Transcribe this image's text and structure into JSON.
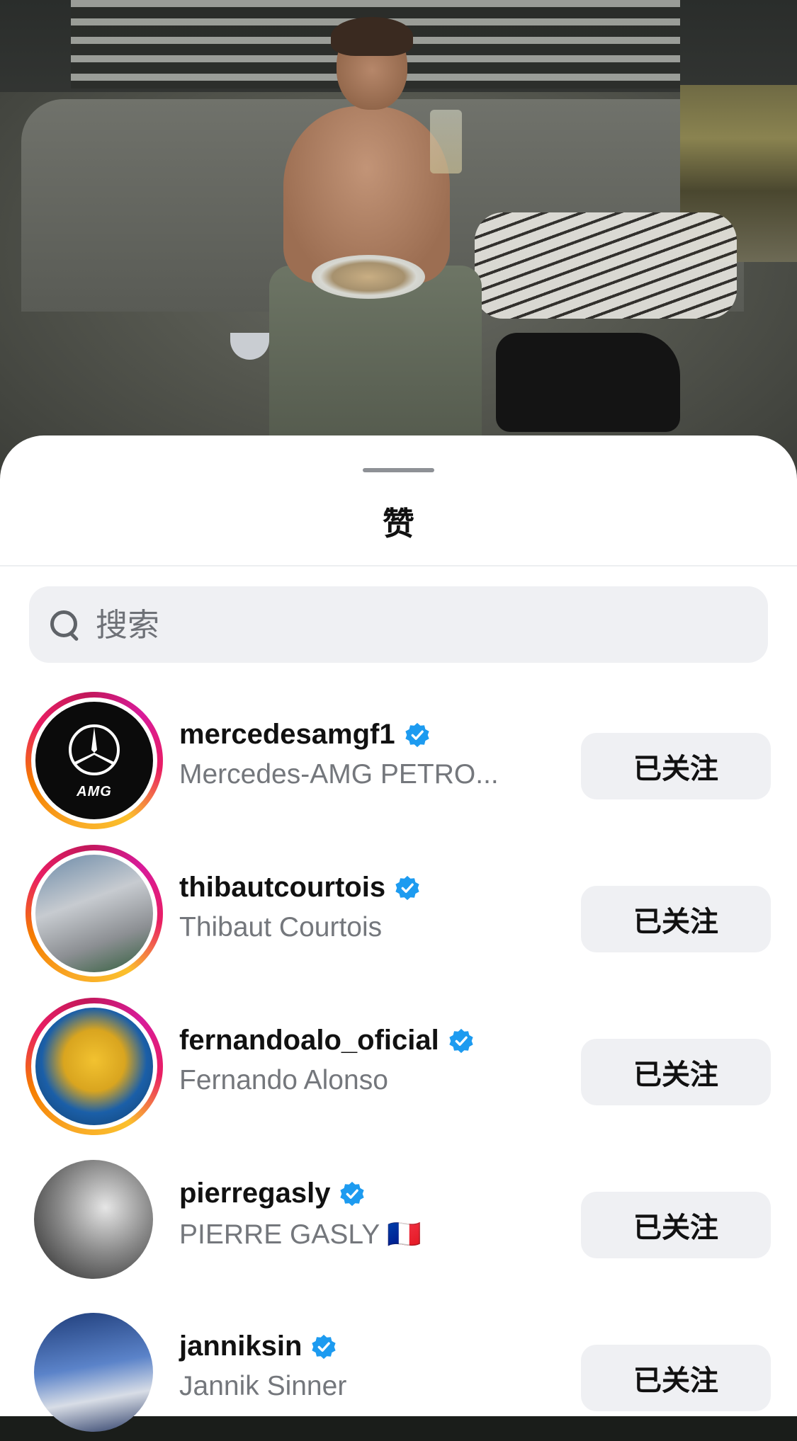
{
  "sheet": {
    "title": "赞"
  },
  "search": {
    "placeholder": "搜索"
  },
  "likers": [
    {
      "username": "mercedesamgf1",
      "full_name": "Mercedes-AMG PETRO...",
      "verified": true,
      "story_ring": true,
      "button": "已关注",
      "avatar_text": "AMG"
    },
    {
      "username": "thibautcourtois",
      "full_name": "Thibaut Courtois",
      "verified": true,
      "story_ring": true,
      "button": "已关注"
    },
    {
      "username": "fernandoalo_oficial",
      "full_name": "Fernando Alonso",
      "verified": true,
      "story_ring": true,
      "button": "已关注"
    },
    {
      "username": "pierregasly",
      "full_name": "PIERRE GASLY 🇫🇷",
      "verified": true,
      "story_ring": false,
      "button": "已关注"
    },
    {
      "username": "janniksin",
      "full_name": "Jannik Sinner",
      "verified": true,
      "story_ring": false,
      "button": "已关注"
    }
  ],
  "colors": {
    "verified_badge": "#1d9bf0",
    "button_bg": "#eff0f3",
    "secondary_text": "#74777c"
  }
}
